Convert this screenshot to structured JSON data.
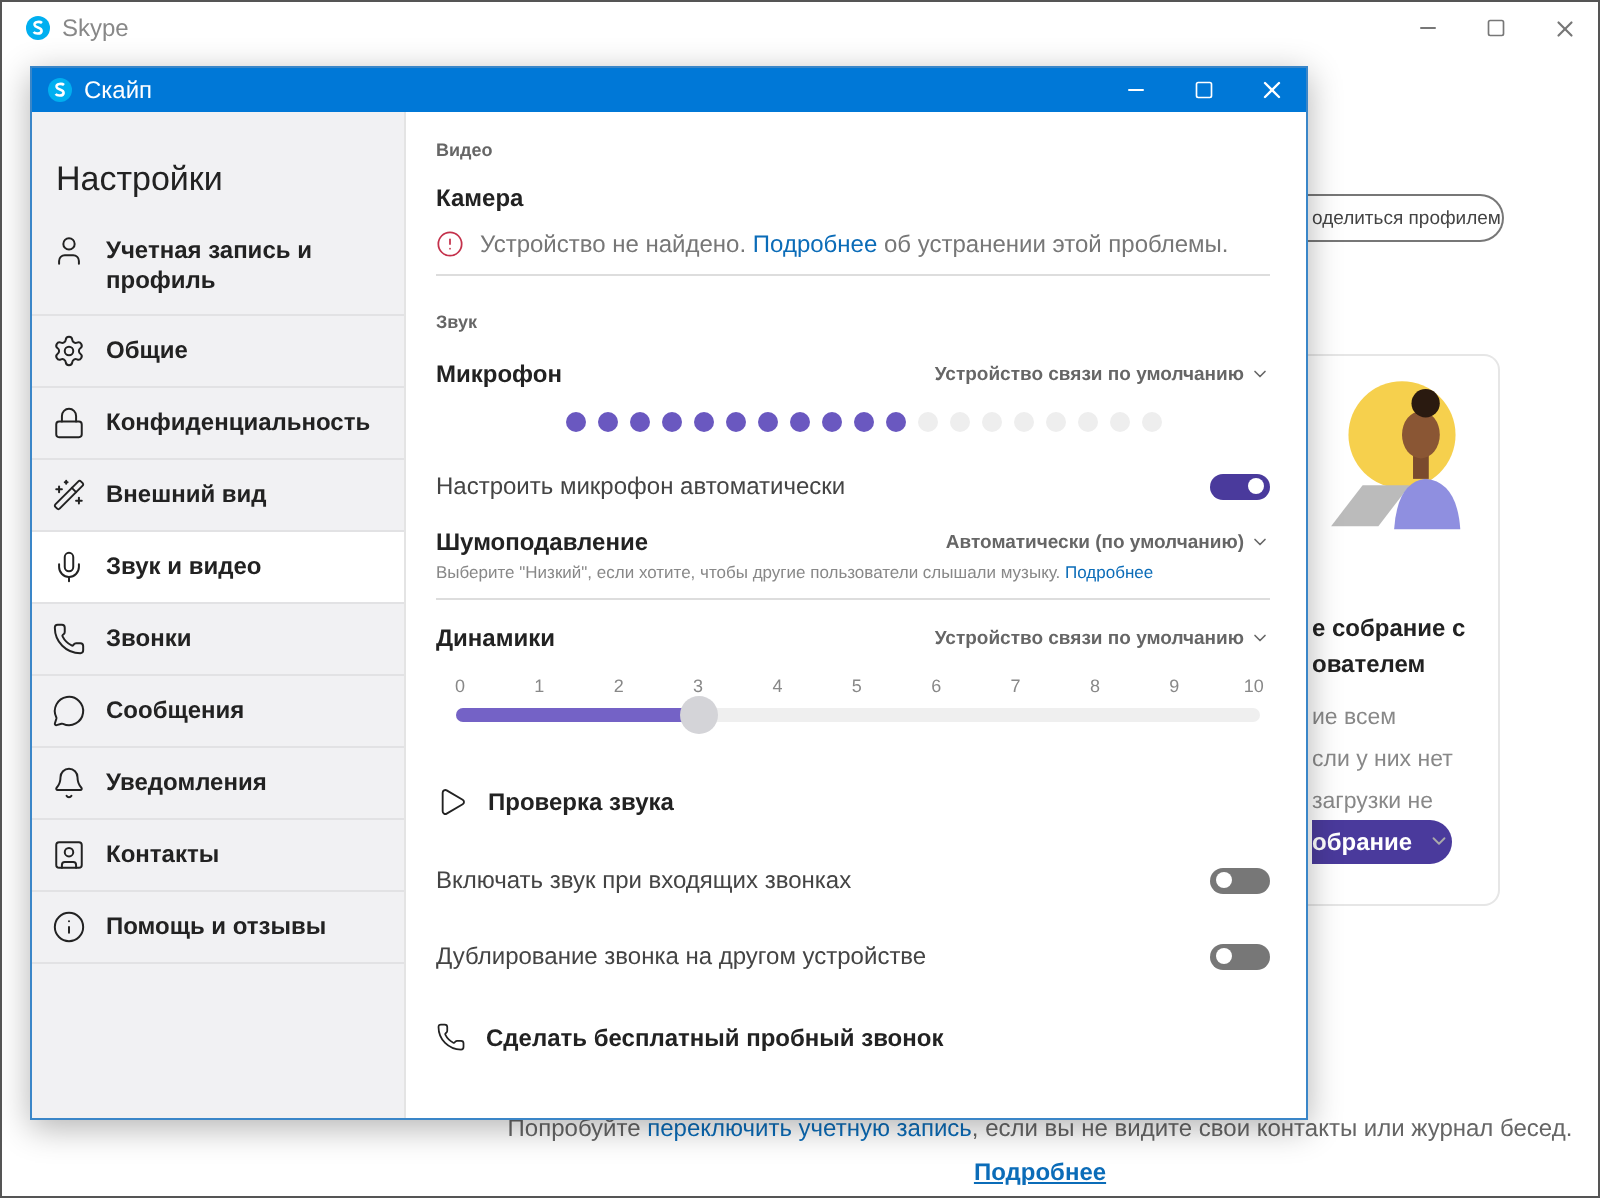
{
  "background_window": {
    "title": "Skype",
    "share_button": "оделиться профилем",
    "card": {
      "title_lines": [
        "е собрание с",
        "ователем"
      ],
      "text_lines": [
        "ие всем",
        "сли у них нет",
        "загрузки не"
      ],
      "button": "обрание"
    },
    "footer": {
      "text_before": "Попробуйте ",
      "link": "переключить учетную запись",
      "text_after": ", если вы не видите свои контакты или журнал бесед.",
      "more_link": "Подробнее"
    }
  },
  "dialog": {
    "title": "Скайп"
  },
  "sidebar": {
    "heading": "Настройки",
    "items": [
      {
        "kind": "account",
        "label": "Учетная запись и профиль",
        "selected": false
      },
      {
        "kind": "general",
        "label": "Общие",
        "selected": false
      },
      {
        "kind": "privacy",
        "label": "Конфиденциальность",
        "selected": false
      },
      {
        "kind": "appearance",
        "label": "Внешний вид",
        "selected": false
      },
      {
        "kind": "audio",
        "label": "Звук и видео",
        "selected": true
      },
      {
        "kind": "calls",
        "label": "Звонки",
        "selected": false
      },
      {
        "kind": "messages",
        "label": "Сообщения",
        "selected": false
      },
      {
        "kind": "notifications",
        "label": "Уведомления",
        "selected": false
      },
      {
        "kind": "contacts",
        "label": "Контакты",
        "selected": false
      },
      {
        "kind": "help",
        "label": "Помощь и отзывы",
        "selected": false
      }
    ]
  },
  "video": {
    "section": "Видео",
    "camera": {
      "label": "Камера",
      "error": "Устройство не найдено.",
      "link": "Подробнее",
      "error_after": "об устранении этой проблемы."
    }
  },
  "audio": {
    "section": "Звук",
    "microphone": {
      "label": "Микрофон",
      "device": "Устройство связи по умолчанию",
      "level": 0.58
    },
    "auto_mic": {
      "label": "Настроить микрофон автоматически",
      "on": true
    },
    "noise": {
      "label": "Шумоподавление",
      "value": "Автоматически (по умолчанию)",
      "hint": "Выберите \"Низкий\", если хотите, чтобы другие пользователи слышали музыку.",
      "link": "Подробнее"
    },
    "speakers": {
      "label": "Динамики",
      "device": "Устройство связи по умолчанию",
      "ticks": [
        "0",
        "1",
        "2",
        "3",
        "4",
        "5",
        "6",
        "7",
        "8",
        "9",
        "10"
      ],
      "level": 0.3
    },
    "test_sound": "Проверка звука",
    "toggles": [
      {
        "label": "Включать звук при входящих звонках",
        "on": false
      },
      {
        "label": "Дублирование звонка на другом устройстве",
        "on": false
      }
    ],
    "test_call": "Сделать бесплатный пробный звонок"
  }
}
